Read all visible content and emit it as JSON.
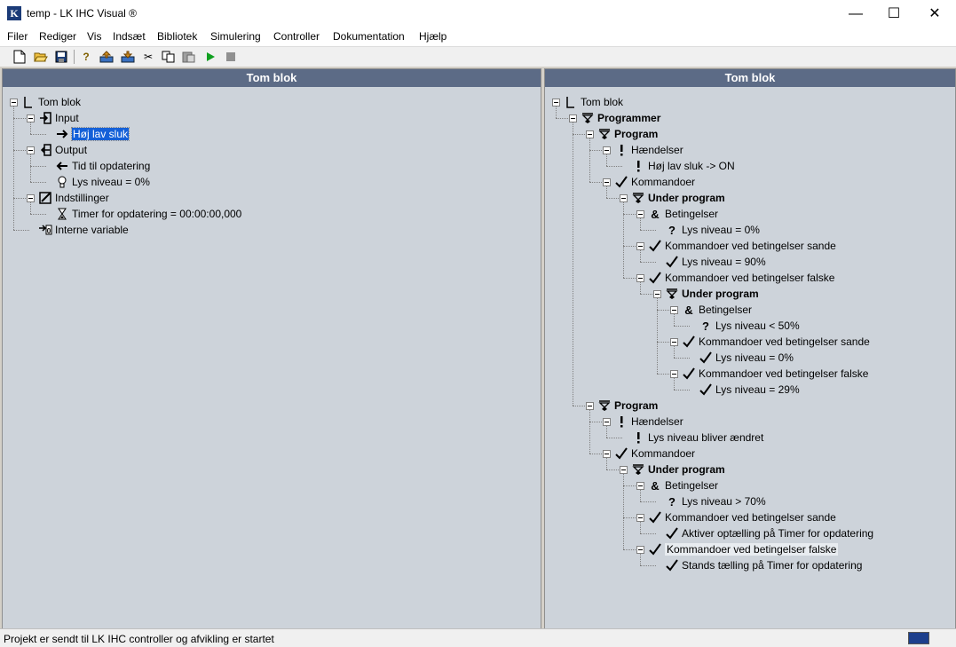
{
  "window": {
    "title": "temp - LK IHC Visual ®",
    "icon_letter": "K"
  },
  "menu": [
    "Filer",
    "Rediger",
    "Vis",
    "Indsæt",
    "Bibliotek",
    "Simulering",
    "Controller",
    "Dokumentation",
    "Hjælp"
  ],
  "toolbar": [
    "new-icon",
    "open-icon",
    "save-icon",
    "help-icon",
    "upload-icon",
    "download-icon",
    "cut-icon",
    "copy-icon",
    "paste-icon",
    "run-icon",
    "stop-icon"
  ],
  "left_pane": {
    "title": "Tom blok",
    "nodes": [
      {
        "label": "Tom blok",
        "icon": "block-icon"
      },
      {
        "label": "Input",
        "icon": "input-icon"
      },
      {
        "label": "Høj lav sluk",
        "icon": "arrow-right-icon"
      },
      {
        "label": "Output",
        "icon": "output-icon"
      },
      {
        "label": "Tid til opdatering",
        "icon": "arrow-left-icon"
      },
      {
        "label": "Lys niveau = 0%",
        "icon": "bulb-icon"
      },
      {
        "label": "Indstillinger",
        "icon": "settings-icon"
      },
      {
        "label": "Timer for opdatering = 00:00:00,000",
        "icon": "hourglass-icon"
      },
      {
        "label": "Interne variable",
        "icon": "variable-icon"
      }
    ]
  },
  "right_pane": {
    "title": "Tom blok",
    "nodes": [
      {
        "label": "Tom blok",
        "icon": "block-icon"
      },
      {
        "label": "Programmer",
        "icon": "program-icon"
      },
      {
        "label": "Program",
        "icon": "program-icon"
      },
      {
        "label": "Hændelser",
        "icon": "exclamation-icon"
      },
      {
        "label": "Høj lav sluk -> ON",
        "icon": "exclamation-icon"
      },
      {
        "label": "Kommandoer",
        "icon": "check-icon"
      },
      {
        "label": "Under program",
        "icon": "program-icon"
      },
      {
        "label": "Betingelser",
        "icon": "ampersand-icon"
      },
      {
        "label": "Lys niveau = 0%",
        "icon": "question-icon"
      },
      {
        "label": "Kommandoer ved betingelser sande",
        "icon": "check-icon"
      },
      {
        "label": "Lys niveau = 90%",
        "icon": "check-icon"
      },
      {
        "label": "Kommandoer ved betingelser falske",
        "icon": "check-icon"
      },
      {
        "label": "Under program",
        "icon": "program-icon"
      },
      {
        "label": "Betingelser",
        "icon": "ampersand-icon"
      },
      {
        "label": "Lys niveau < 50%",
        "icon": "question-icon"
      },
      {
        "label": "Kommandoer ved betingelser sande",
        "icon": "check-icon"
      },
      {
        "label": "Lys niveau = 0%",
        "icon": "check-icon"
      },
      {
        "label": "Kommandoer ved betingelser falske",
        "icon": "check-icon"
      },
      {
        "label": "Lys niveau = 29%",
        "icon": "check-icon"
      },
      {
        "label": "Program",
        "icon": "program-icon"
      },
      {
        "label": "Hændelser",
        "icon": "exclamation-icon"
      },
      {
        "label": "Lys niveau bliver ændret",
        "icon": "exclamation-icon"
      },
      {
        "label": "Kommandoer",
        "icon": "check-icon"
      },
      {
        "label": "Under program",
        "icon": "program-icon"
      },
      {
        "label": "Betingelser",
        "icon": "ampersand-icon"
      },
      {
        "label": "Lys niveau > 70%",
        "icon": "question-icon"
      },
      {
        "label": "Kommandoer ved betingelser sande",
        "icon": "check-icon"
      },
      {
        "label": "Aktiver optælling på Timer for opdatering",
        "icon": "check-icon"
      },
      {
        "label": "Kommandoer ved betingelser falske",
        "icon": "check-icon"
      },
      {
        "label": "Stands tælling på Timer for opdatering",
        "icon": "check-icon"
      }
    ]
  },
  "status": {
    "text": "Projekt er sendt til LK IHC controller og afvikling er startet"
  }
}
